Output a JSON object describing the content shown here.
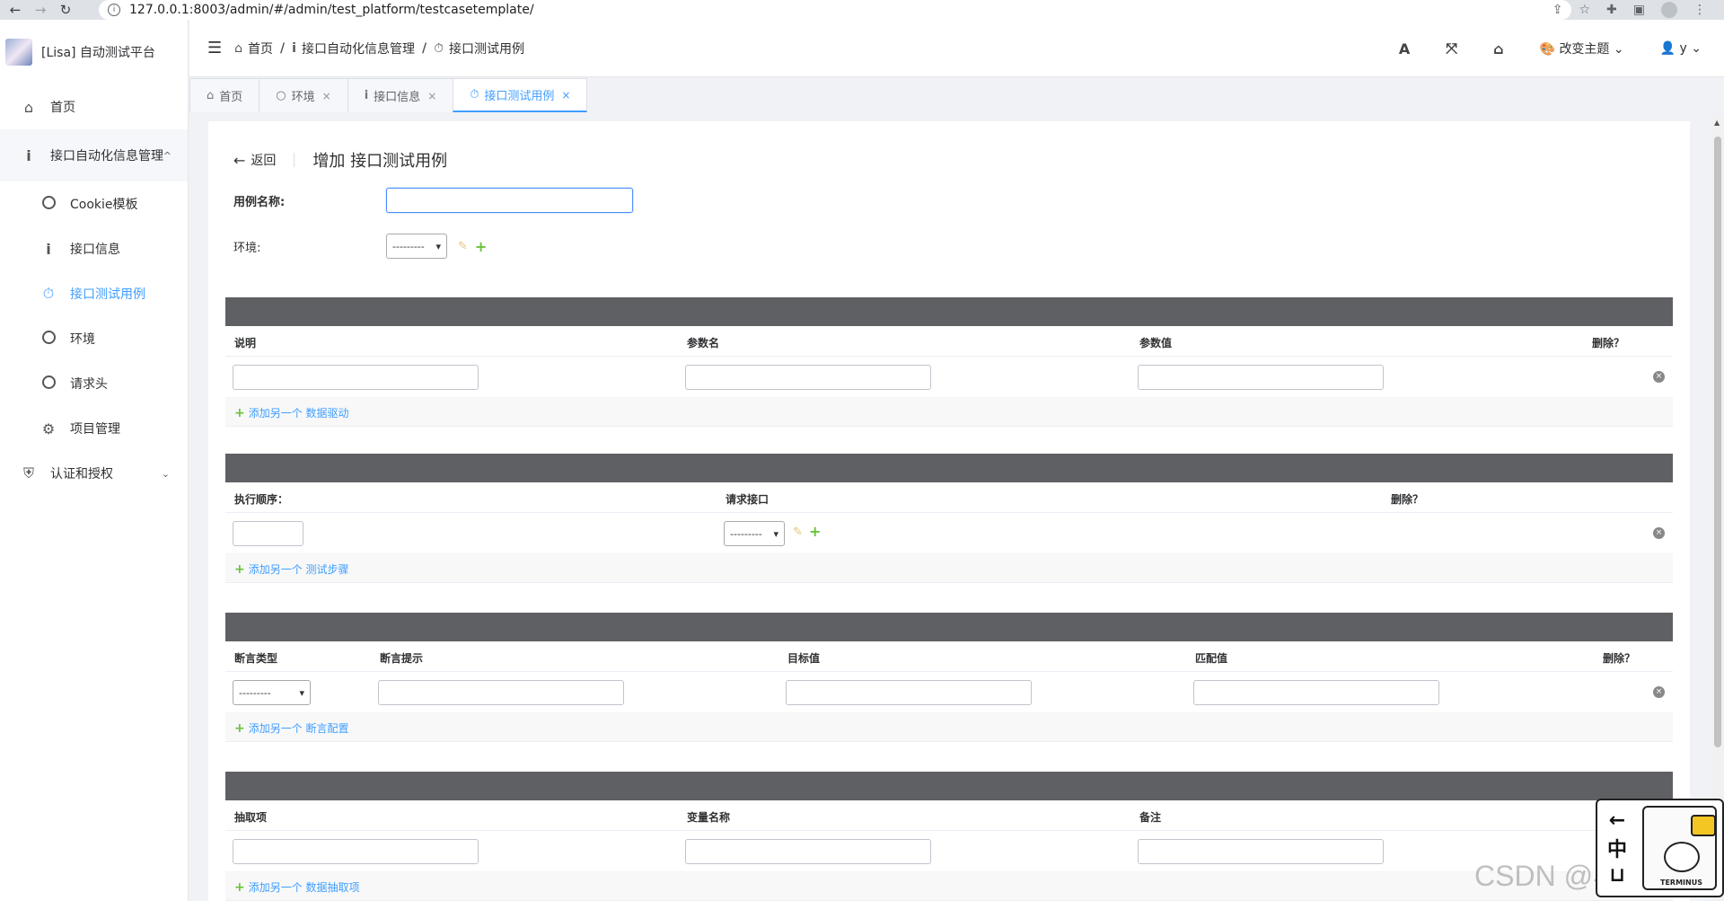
{
  "browser": {
    "url": "127.0.0.1:8003/admin/#/admin/test_platform/testcasetemplate/"
  },
  "sidebar": {
    "app_title": "[Lisa] 自动测试平台",
    "items": [
      {
        "label": "首页"
      },
      {
        "label": "接口自动化信息管理"
      },
      {
        "label": "Cookie模板"
      },
      {
        "label": "接口信息"
      },
      {
        "label": "接口测试用例"
      },
      {
        "label": "环境"
      },
      {
        "label": "请求头"
      },
      {
        "label": "项目管理"
      },
      {
        "label": "认证和授权"
      }
    ]
  },
  "header": {
    "breadcrumb": [
      "首页",
      "接口自动化信息管理",
      "接口测试用例"
    ],
    "theme_label": "改变主题",
    "user_label": "y"
  },
  "tabs": [
    {
      "label": "首页"
    },
    {
      "label": "环境"
    },
    {
      "label": "接口信息"
    },
    {
      "label": "接口测试用例"
    }
  ],
  "page": {
    "back_label": "返回",
    "title": "增加 接口测试用例",
    "case_name_label": "用例名称:",
    "case_name_value": "",
    "env_label": "环境:",
    "env_select": "---------"
  },
  "sections": {
    "data_driven": {
      "columns": [
        "说明",
        "参数名",
        "参数值",
        "删除？"
      ],
      "add_label": "添加另一个 数据驱动"
    },
    "test_steps": {
      "columns": [
        "执行顺序：",
        "请求接口",
        "删除？"
      ],
      "select_value": "---------",
      "add_label": "添加另一个 测试步骤"
    },
    "assertions": {
      "columns": [
        "断言类型",
        "断言提示",
        "目标值",
        "匹配值",
        "删除？"
      ],
      "select_value": "---------",
      "add_label": "添加另一个 断言配置"
    },
    "extract": {
      "columns": [
        "抽取项",
        "变量名称",
        "备注"
      ],
      "add_label": "添加另一个 数据抽取项"
    }
  },
  "overlay": {
    "watermark": "CSDN @小彭一张",
    "widget_chars": [
      "←",
      "中",
      "⊔"
    ],
    "widget_brand": "TERMINUS"
  }
}
